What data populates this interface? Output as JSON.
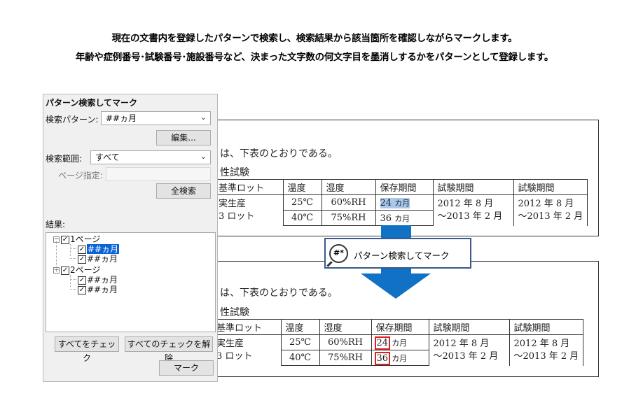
{
  "headline": {
    "line1": "現在の文書内を登録したパターンで検索し、検索結果から該当箇所を確認しながらマークします。",
    "line2": "年齢や症例番号･試験番号･施設番号など、決まった文字数の何文字目を墨消しするかをパターンとして登録します。"
  },
  "document": {
    "sentence": "は、下表のとおりである。",
    "section": "性試験",
    "table": {
      "headers": [
        "基準ロット",
        "温度",
        "湿度",
        "保存期間",
        "試験期間",
        "試験期間"
      ],
      "lot": [
        "実生産",
        "3 ロット"
      ],
      "rows": [
        {
          "temp": "25℃",
          "humidity": "60%RH",
          "period_num": "24",
          "period_unit": "カ月"
        },
        {
          "temp": "40℃",
          "humidity": "75%RH",
          "period_num": "36",
          "period_unit": "カ月"
        }
      ],
      "test_period": [
        "2012 年 8 月",
        "～2013 年 2 月"
      ]
    }
  },
  "badge": {
    "icon_text": "#*",
    "label": "パターン検索してマーク"
  },
  "panel": {
    "title": "パターン検索してマーク",
    "pattern_label": "検索パターン:",
    "pattern_value": "##ヵ月",
    "edit_button": "編集...",
    "range_label": "検索範囲:",
    "range_value": "すべて",
    "page_label": "ページ指定:",
    "search_all_button": "全検索",
    "results_label": "結果:",
    "tree": [
      {
        "label": "1ページ",
        "children": [
          "##ヵ月",
          "##ヵ月"
        ]
      },
      {
        "label": "2ページ",
        "children": [
          "##ヵ月",
          "##ヵ月"
        ]
      }
    ],
    "check_all_button": "すべてをチェック",
    "uncheck_all_button": "すべてのチェックを解除",
    "mark_button": "マーク"
  },
  "colors": {
    "arrow": "#1071c5",
    "selection": "#a9c9ec",
    "mark_box": "#e02020",
    "tree_selected": "#0a64d8"
  }
}
